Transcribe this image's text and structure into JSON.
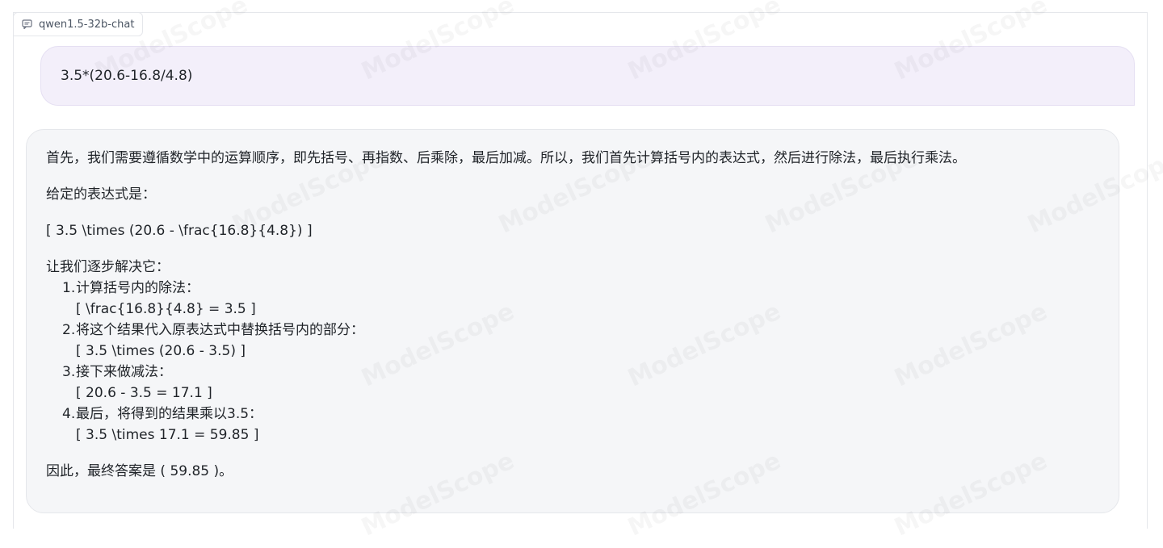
{
  "model_tab": {
    "label": "qwen1.5-32b-chat",
    "icon": "chat-bubble-icon"
  },
  "user_message": {
    "text": "3.5*(20.6-16.8/4.8)"
  },
  "assistant_message": {
    "intro": "首先，我们需要遵循数学中的运算顺序，即先括号、再指数、后乘除，最后加减。所以，我们首先计算括号内的表达式，然后进行除法，最后执行乘法。",
    "given_label": "给定的表达式是：",
    "expression": "[ 3.5 \\times (20.6 - \\frac{16.8}{4.8}) ]",
    "steps_intro": "让我们逐步解决它：",
    "steps": [
      {
        "title": "计算括号内的除法：",
        "formula": "[ \\frac{16.8}{4.8} = 3.5 ]"
      },
      {
        "title": "将这个结果代入原表达式中替换括号内的部分：",
        "formula": "[ 3.5 \\times (20.6 - 3.5) ]"
      },
      {
        "title": "接下来做减法：",
        "formula": "[ 20.6 - 3.5 = 17.1 ]"
      },
      {
        "title": "最后，将得到的结果乘以3.5：",
        "formula": "[ 3.5 \\times 17.1 = 59.85 ]"
      }
    ],
    "final": "因此，最终答案是 ( 59.85 )。"
  },
  "watermark_text": "ModelScope"
}
